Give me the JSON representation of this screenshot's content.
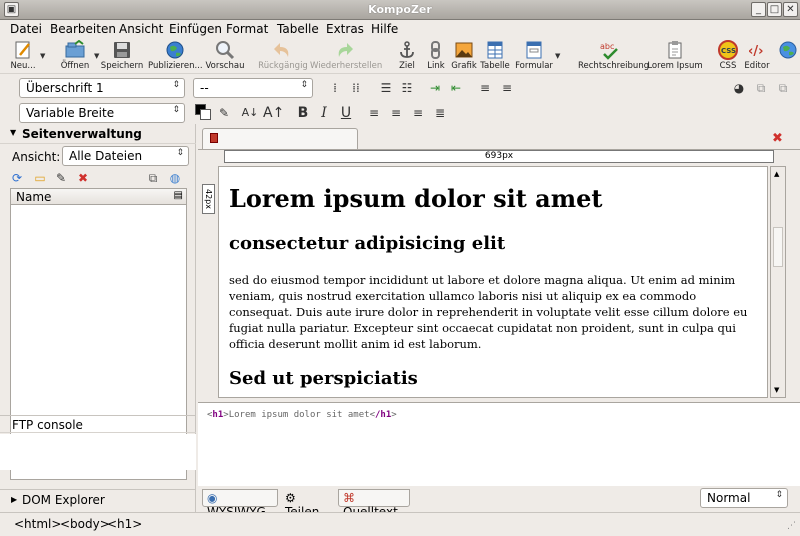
{
  "window": {
    "title": "KompoZer"
  },
  "menu": [
    "Datei",
    "Bearbeiten",
    "Ansicht",
    "Einfügen",
    "Format",
    "Tabelle",
    "Extras",
    "Hilfe"
  ],
  "toolbar": {
    "new": "Neu...",
    "open": "Öffnen",
    "save": "Speichern",
    "publish": "Publizieren...",
    "preview": "Vorschau",
    "undo": "Rückgängig",
    "redo": "Wiederherstellen",
    "anchor": "Ziel",
    "link": "Link",
    "image": "Grafik",
    "table": "Tabelle",
    "form": "Formular",
    "spell": "Rechtschreibung",
    "lorem": "Lorem Ipsum",
    "css": "CSS",
    "editor": "Editor"
  },
  "format": {
    "paragraph": "Überschrift 1",
    "font": "--",
    "width": "Variable Breite"
  },
  "sidebar": {
    "title": "Seitenverwaltung",
    "view_label": "Ansicht:",
    "view_value": "Alle Dateien",
    "name_header": "Name",
    "ftp": "FTP console",
    "dom": "DOM Explorer"
  },
  "editor": {
    "width_ruler": "693px",
    "height_ruler": "42px",
    "h1": "Lorem ipsum dolor sit amet",
    "h2": "consectetur adipisicing elit",
    "paragraph": "sed do eiusmod tempor incididunt ut labore et dolore magna aliqua. Ut enim ad minim veniam, quis nostrud exercitation ullamco laboris nisi ut aliquip ex ea commodo consequat. Duis aute irure dolor in reprehenderit in voluptate velit esse cillum dolore eu fugiat nulla pariatur. Excepteur sint occaecat cupidatat non proident, sunt in culpa qui officia deserunt mollit anim id est laborum.",
    "h3": "Sed ut perspiciatis",
    "source_open": "h1",
    "source_text": "Lorem ipsum dolor sit amet",
    "source_close": "/h1"
  },
  "modes": {
    "wysiwyg": "WYSIWYG",
    "split": "Teilen",
    "source": "Quelltext",
    "view": "Normal"
  },
  "status": {
    "crumbs": [
      "<html>",
      "<body>",
      "<h1>"
    ]
  }
}
